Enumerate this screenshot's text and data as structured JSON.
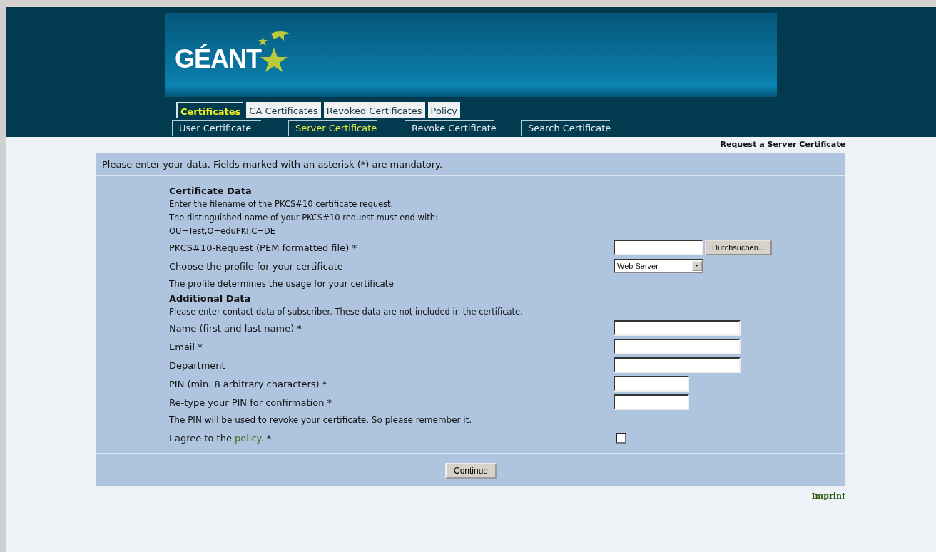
{
  "logo": {
    "text": "GÉANT"
  },
  "tabs": [
    {
      "label": "Certificates",
      "selected": true
    },
    {
      "label": "CA Certificates",
      "selected": false
    },
    {
      "label": "Revoked Certificates",
      "selected": false
    },
    {
      "label": "Policy",
      "selected": false
    }
  ],
  "subtabs": [
    {
      "label": "User Certificate",
      "selected": false
    },
    {
      "label": "Server Certificate",
      "selected": true
    },
    {
      "label": "Revoke Certificate",
      "selected": false
    },
    {
      "label": "Search Certificate",
      "selected": false
    }
  ],
  "page_title": "Request a Server Certificate",
  "intro": "Please enter your data. Fields marked with an asterisk (*) are mandatory.",
  "sections": [
    {
      "heading": "Certificate Data",
      "lines": [
        "Enter the filename of the PKCS#10 certificate request.",
        "The distinguished name of your PKCS#10 request must end with:",
        "OU=Test,O=eduPKI,C=DE"
      ],
      "rows": [
        {
          "kind": "file",
          "label": "PKCS#10-Request (PEM formatted file) *",
          "button": "Durchsuchen..."
        },
        {
          "kind": "select",
          "label": "Choose the profile for your certificate",
          "value": "Web Server"
        },
        {
          "kind": "note",
          "label": "The profile determines the usage for your certificate"
        }
      ]
    },
    {
      "heading": "Additional Data",
      "lines": [
        "Please enter contact data of subscriber. These data are not included in the certificate."
      ],
      "rows": [
        {
          "kind": "text",
          "label": "Name (first and last name) *"
        },
        {
          "kind": "text",
          "label": "Email *"
        },
        {
          "kind": "text",
          "label": "Department"
        },
        {
          "kind": "short",
          "label": "PIN (min. 8 arbitrary characters) *"
        },
        {
          "kind": "short",
          "label": "Re-type your PIN for confirmation *"
        },
        {
          "kind": "note",
          "label": "The PIN will be used to revoke your certificate. So please remember it."
        },
        {
          "kind": "checkbox",
          "label": "I agree to the ",
          "link": "policy.",
          "suffix": " *",
          "checked": false
        }
      ]
    }
  ],
  "submit": "Continue",
  "footer_link": "Imprint"
}
